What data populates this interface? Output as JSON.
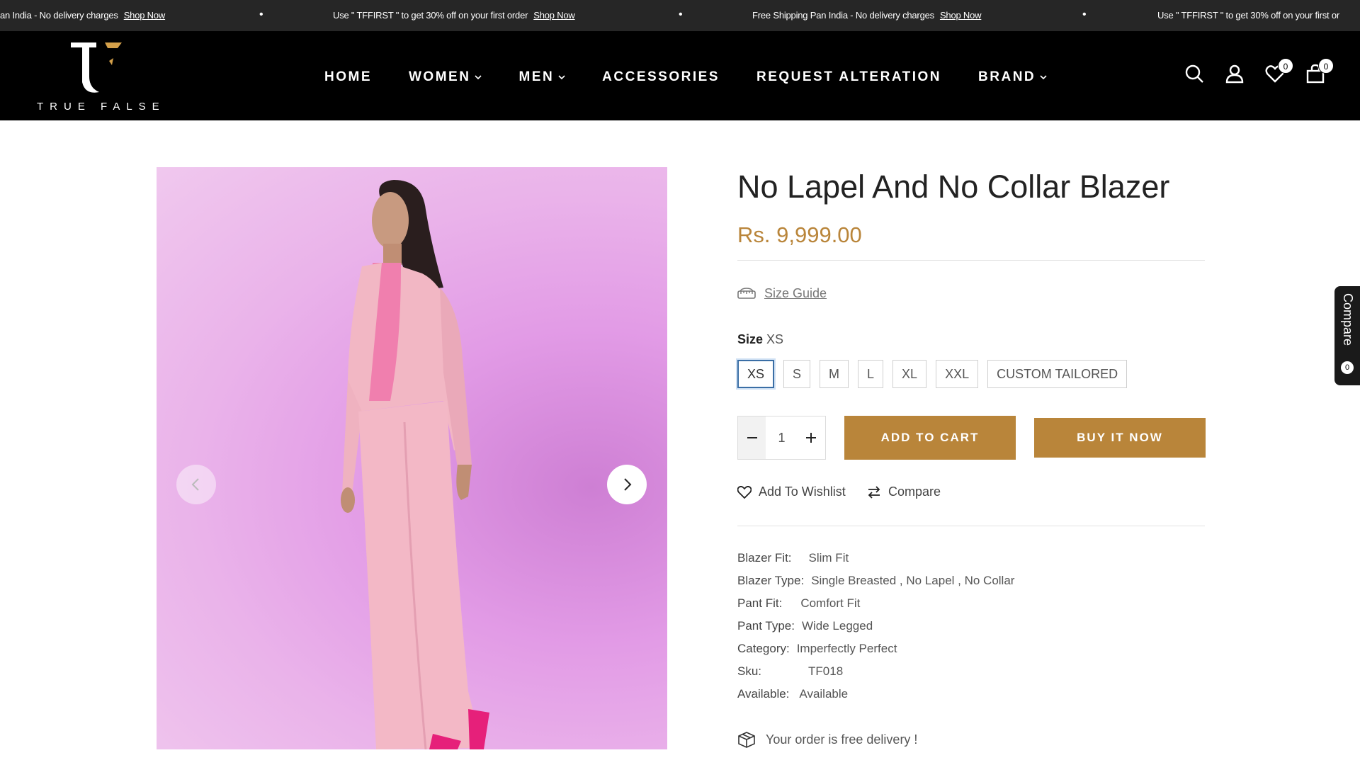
{
  "announcement": {
    "items": [
      {
        "text": "an India - No delivery charges",
        "link": "Shop Now"
      },
      {
        "text": "Use \" TFFIRST \" to get 30% off on your first order",
        "link": "Shop Now"
      },
      {
        "text": "Free Shipping Pan India - No delivery charges",
        "link": "Shop Now"
      },
      {
        "text": "Use \" TFFIRST \" to get 30% off on your first or",
        "link": ""
      }
    ],
    "separator": "•"
  },
  "header": {
    "logo_text": "TRUE FALSE",
    "nav": [
      {
        "label": "HOME",
        "dropdown": false
      },
      {
        "label": "WOMEN",
        "dropdown": true
      },
      {
        "label": "MEN",
        "dropdown": true
      },
      {
        "label": "ACCESSORIES",
        "dropdown": false
      },
      {
        "label": "REQUEST ALTERATION",
        "dropdown": false
      },
      {
        "label": "BRAND",
        "dropdown": true
      }
    ],
    "wishlist_count": "0",
    "cart_count": "0"
  },
  "product": {
    "title": "No Lapel And No Collar Blazer",
    "price": "Rs. 9,999.00",
    "size_guide_label": "Size Guide",
    "size_label": "Size",
    "selected_size": "XS",
    "sizes": [
      "XS",
      "S",
      "M",
      "L",
      "XL",
      "XXL",
      "CUSTOM TAILORED"
    ],
    "quantity": "1",
    "add_to_cart_label": "ADD TO CART",
    "buy_now_label": "BUY IT NOW",
    "wishlist_label": "Add To Wishlist",
    "compare_label": "Compare",
    "specs": [
      {
        "key": "Blazer Fit:",
        "value": "Slim Fit"
      },
      {
        "key": "Blazer Type:",
        "value": "Single Breasted , No Lapel , No Collar"
      },
      {
        "key": "Pant Fit:",
        "value": "Comfort Fit"
      },
      {
        "key": "Pant Type:",
        "value": "Wide Legged"
      },
      {
        "key": "Category:",
        "value": "Imperfectly Perfect"
      },
      {
        "key": "Sku:",
        "value": "TF018"
      },
      {
        "key": "Available:",
        "value": "Available"
      }
    ],
    "delivery_note": "Your order is free delivery !"
  },
  "compare_tab": {
    "label": "Compare",
    "count": "0"
  },
  "colors": {
    "accent": "#b9853a",
    "header_bg": "#000000",
    "announce_bg": "#262626"
  }
}
